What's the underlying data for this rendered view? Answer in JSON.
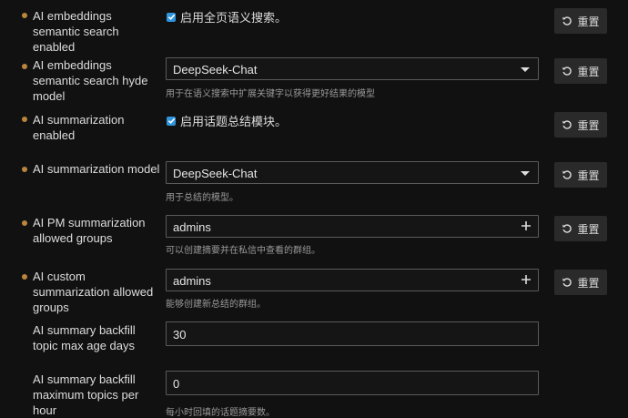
{
  "settings": [
    {
      "label": "AI embeddings semantic search enabled",
      "type": "checkbox",
      "checked": true,
      "checkbox_label": "启用全页语义搜索。",
      "reset": "重置"
    },
    {
      "label": "AI embeddings semantic search hyde model",
      "type": "select",
      "value": "DeepSeek-Chat",
      "hint": "用于在语义搜索中扩展关键字以获得更好结果的模型",
      "reset": "重置"
    },
    {
      "label": "AI summarization enabled",
      "type": "checkbox",
      "checked": true,
      "checkbox_label": "启用话题总结模块。",
      "reset": "重置"
    },
    {
      "label": "AI summarization model",
      "type": "select",
      "value": "DeepSeek-Chat",
      "hint": "用于总结的模型。",
      "reset": "重置"
    },
    {
      "label": "AI PM summarization allowed groups",
      "type": "group",
      "value": "admins",
      "hint": "可以创建摘要并在私信中查看的群组。",
      "reset": "重置"
    },
    {
      "label": "AI custom summarization allowed groups",
      "type": "group",
      "value": "admins",
      "hint": "能够创建新总结的群组。",
      "reset": "重置"
    },
    {
      "label": "AI summary backfill topic max age days",
      "type": "number",
      "value": "30"
    },
    {
      "label": "AI summary backfill maximum topics per hour",
      "type": "number",
      "value": "0",
      "hint": "每小时回填的话题摘要数。"
    }
  ]
}
